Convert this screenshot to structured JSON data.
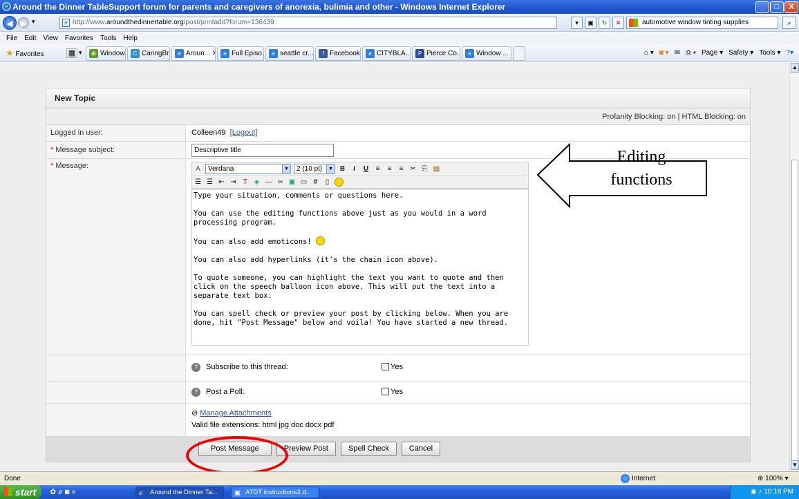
{
  "window": {
    "title": "Around the Dinner TableSupport forum for parents and caregivers of anorexia, bulimia and other  - Windows Internet Explorer",
    "min": "_",
    "max": "□",
    "close": "X"
  },
  "address": {
    "url_prefix": "http://www.",
    "url_domain": "aroundthedinnertable.org",
    "url_path": "/post/printadd?forum=136439",
    "search_value": "automotive window tinting supplies"
  },
  "menu": [
    "File",
    "Edit",
    "View",
    "Favorites",
    "Tools",
    "Help"
  ],
  "favorites_label": "Favorites",
  "tabs": [
    {
      "label": "Windows ...",
      "icon": "windows-icon"
    },
    {
      "label": "CaringBri...",
      "icon": "caringbridge-icon"
    },
    {
      "label": "Aroun...",
      "icon": "ie-icon",
      "active": true
    },
    {
      "label": "Full Episo...",
      "icon": "ie-icon"
    },
    {
      "label": "seattle cr...",
      "icon": "ie-icon"
    },
    {
      "label": "Facebook",
      "icon": "facebook-icon"
    },
    {
      "label": "CITYBLA...",
      "icon": "ie-icon"
    },
    {
      "label": "Pierce Co...",
      "icon": "pierce-icon"
    },
    {
      "label": "Window ...",
      "icon": "ie-icon"
    }
  ],
  "toolbar_right": [
    "Page ▾",
    "Safety ▾",
    "Tools ▾"
  ],
  "form": {
    "heading": "New Topic",
    "blocking": "Profanity Blocking: on | HTML Blocking: on",
    "logged_in_label": "Logged in user:",
    "user": "Colleen49",
    "logout": "[Logout]",
    "subject_label": "Message subject:",
    "subject_value": "Descriptive title",
    "message_label": "Message:",
    "font": "Verdana",
    "size": "2 (10 pt)",
    "message_paragraphs": [
      "Type your situation, comments or questions here.",
      "You can use the editing functions above just as you would in a word processing program.",
      "You can also add emoticons!",
      "You can also add hyperlinks (it's the chain icon above).",
      "To quote someone, you can highlight the text you want to quote and then click on the speech balloon icon above.  This will put the text into a separate text box.",
      "You can spell check or preview your post by clicking below.  When you are done, hit \"Post Message\" below and voila!  You have started a new thread."
    ],
    "subscribe_label": "Subscribe to this thread:",
    "poll_label": "Post a Poll:",
    "yes": "Yes",
    "attachments_link": "Manage Attachments",
    "extensions": "Valid file extensions: html jpg doc docx pdf",
    "buttons": {
      "post": "Post Message",
      "preview": "Preview Post",
      "spell": "Spell Check",
      "cancel": "Cancel"
    }
  },
  "annotation": {
    "callout_line1": "Editing",
    "callout_line2": "functions",
    "arrow_color": "#000000",
    "circle_color": "#e00000"
  },
  "status": {
    "text": "Done",
    "zone": "Internet",
    "zoom": "100%"
  },
  "taskbar": {
    "start": "start",
    "items": [
      "Around the Dinner Ta...",
      "ATDT instructions2.d..."
    ],
    "clock": "10:18 PM"
  }
}
